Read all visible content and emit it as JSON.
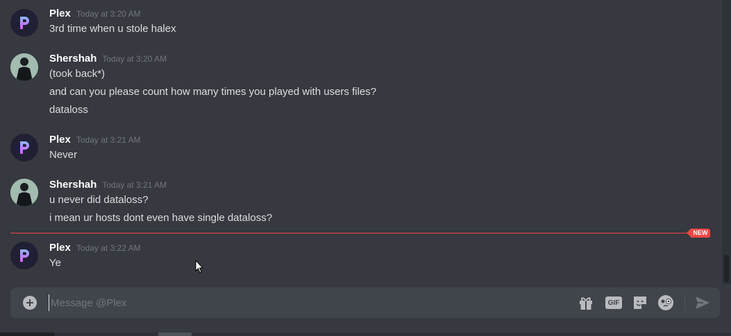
{
  "messages": [
    {
      "author": "Plex",
      "timestamp": "Today at 3:20 AM",
      "lines": [
        "3rd time when u stole halex"
      ]
    },
    {
      "author": "Shershah",
      "timestamp": "Today at 3:20 AM",
      "lines": [
        "(took back*)",
        "and can you please count how many times you played with users files?",
        "dataloss"
      ]
    },
    {
      "author": "Plex",
      "timestamp": "Today at 3:21 AM",
      "lines": [
        "Never"
      ]
    },
    {
      "author": "Shershah",
      "timestamp": "Today at 3:21 AM",
      "lines": [
        "u never did dataloss?",
        "i mean ur hosts dont even have single dataloss?"
      ]
    },
    {
      "author": "Plex",
      "timestamp": "Today at 3:22 AM",
      "lines": [
        "Ye"
      ]
    }
  ],
  "new_badge": "NEW",
  "composer": {
    "placeholder": "Message @Plex",
    "icons": [
      "plus-circle-icon",
      "gift-icon",
      "gif-icon",
      "sticker-icon",
      "emoji-icon",
      "send-icon"
    ],
    "gif_label": "GIF"
  },
  "colors": {
    "background": "#36393f",
    "composer": "#40444b",
    "new_divider": "#f04747",
    "author": "#ffffff",
    "timestamp": "#72767d"
  }
}
